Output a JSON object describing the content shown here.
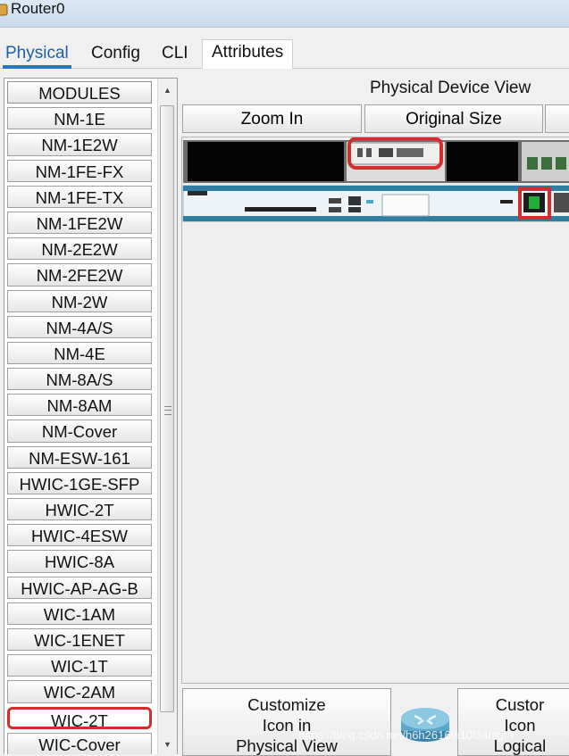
{
  "window": {
    "title": "Router0",
    "app_icon": "router-app-icon"
  },
  "tabs": [
    {
      "label": "Physical",
      "active": true
    },
    {
      "label": "Config",
      "active": false
    },
    {
      "label": "CLI",
      "active": false
    },
    {
      "label": "Attributes",
      "active": false
    }
  ],
  "modules": {
    "header": "MODULES",
    "items": [
      "NM-1E",
      "NM-1E2W",
      "NM-1FE-FX",
      "NM-1FE-TX",
      "NM-1FE2W",
      "NM-2E2W",
      "NM-2FE2W",
      "NM-2W",
      "NM-4A/S",
      "NM-4E",
      "NM-8A/S",
      "NM-8AM",
      "NM-Cover",
      "NM-ESW-161",
      "HWIC-1GE-SFP",
      "HWIC-2T",
      "HWIC-4ESW",
      "HWIC-8A",
      "HWIC-AP-AG-B",
      "WIC-1AM",
      "WIC-1ENET",
      "WIC-1T",
      "WIC-2AM",
      "WIC-2T",
      "WIC-Cover"
    ],
    "selected": "WIC-2T"
  },
  "physical_view": {
    "title": "Physical Device View",
    "zoom_in_label": "Zoom In",
    "original_size_label": "Original Size"
  },
  "bottom": {
    "customize_physical": [
      "Customize",
      "Icon in",
      "Physical View"
    ],
    "customize_logical": [
      "Custor",
      "Icon",
      "Logical"
    ]
  },
  "watermark": "https://blog.csdn.net/h6h26169i10l34fsgm",
  "colors": {
    "accent": "#2a75c6",
    "highlight": "#d32e2e",
    "power_switch": "#1fae3a"
  }
}
